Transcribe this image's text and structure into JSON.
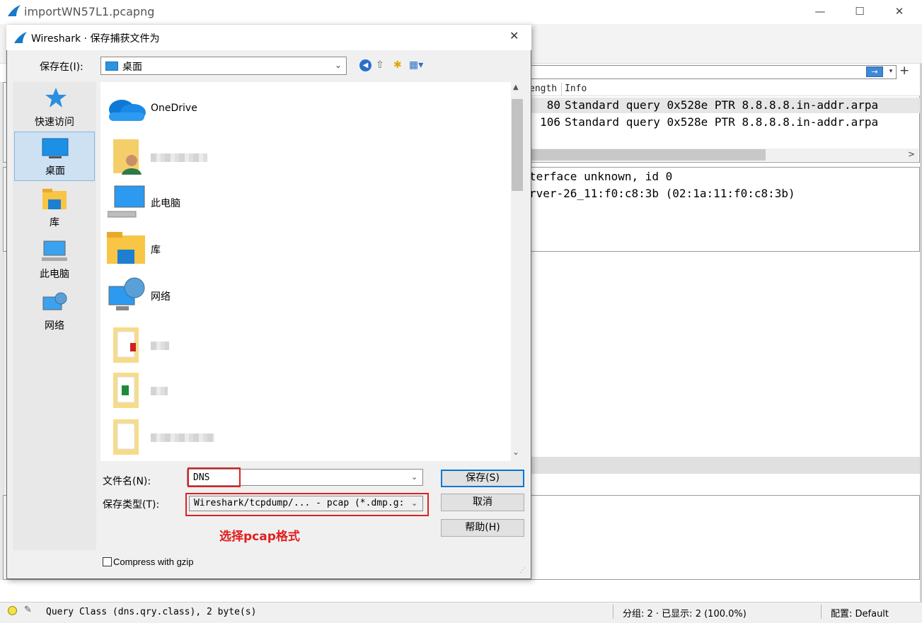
{
  "main_window": {
    "title": "importWN57L1.pcapng",
    "minimize": "—",
    "maximize": "☐",
    "close": "✕"
  },
  "filter_bar": {
    "apply_icon": "→",
    "dropdown": "▾",
    "add": "+"
  },
  "packet_list": {
    "columns": [
      "ength",
      "Info"
    ],
    "rows": [
      {
        "length": "80",
        "info": "Standard query 0x528e PTR 8.8.8.8.in-addr.arpa"
      },
      {
        "length": "106",
        "info": "Standard query 0x528e PTR 8.8.8.8.in-addr.arpa"
      }
    ],
    "hscroll_arrow": ">"
  },
  "details": {
    "lines": [
      "terface unknown, id 0",
      "rver-26_11:f0:c8:3b (02:1a:11:f0:c8:3b)"
    ]
  },
  "statusbar": {
    "field_info": "Query Class (dns.qry.class), 2 byte(s)",
    "packets": "分组: 2 · 已显示: 2 (100.0%)",
    "profile": "配置: Default"
  },
  "dialog": {
    "title": "Wireshark · 保存捕获文件为",
    "close": "✕",
    "save_in_label": "保存在(I):",
    "save_in_value": "桌面",
    "places": [
      {
        "label": "快速访问",
        "icon": "star-icon"
      },
      {
        "label": "桌面",
        "icon": "desktop-icon"
      },
      {
        "label": "库",
        "icon": "library-icon"
      },
      {
        "label": "此电脑",
        "icon": "computer-icon"
      },
      {
        "label": "网络",
        "icon": "network-icon"
      }
    ],
    "files": [
      {
        "label": "OneDrive",
        "icon": "onedrive-icon"
      },
      {
        "label": "",
        "icon": "user-folder-icon"
      },
      {
        "label": "此电脑",
        "icon": "computer-icon"
      },
      {
        "label": "库",
        "icon": "library-icon"
      },
      {
        "label": "网络",
        "icon": "network-icon"
      },
      {
        "label": "",
        "icon": "folder-icon"
      },
      {
        "label": "",
        "icon": "folder-icon"
      },
      {
        "label": "",
        "icon": "folder-icon"
      }
    ],
    "filename_label": "文件名(N):",
    "filename_value": "DNS",
    "filetype_label": "保存类型(T):",
    "filetype_value": "Wireshark/tcpdump/... - pcap (*.dmp.g:",
    "annotation": "选择pcap格式",
    "buttons": {
      "save": "保存(S)",
      "cancel": "取消",
      "help": "帮助(H)"
    },
    "gzip_label": "Compress with gzip"
  }
}
